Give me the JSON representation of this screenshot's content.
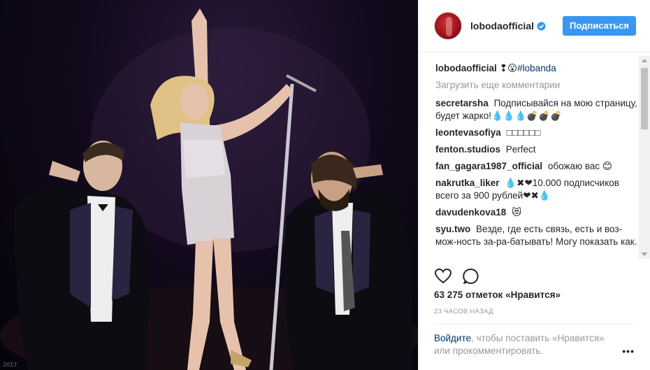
{
  "photo": {
    "watermark": "2017",
    "description_icon": "concert-photo"
  },
  "header": {
    "username": "lobodaofficial",
    "verified_icon": "verified-badge-icon",
    "follow_label": "Подписаться"
  },
  "caption": {
    "username": "lobodaofficial",
    "emoji": "❢😮",
    "hashtag": "#lobanda"
  },
  "load_more": "Загрузить еще комментарии",
  "comments": [
    {
      "user": "secretarsha",
      "text": "Подписывайся на мою страницу, будет жарко!💧💧💧💣💣💣"
    },
    {
      "user": "leontevasofiya",
      "text": "□□□□□□"
    },
    {
      "user": "fenton.studios",
      "text": "Perfect"
    },
    {
      "user": "fan_gagara1987_official",
      "text": "обожаю вас 😊"
    },
    {
      "user": "nakrutka_liker",
      "text": "💧✖❤10.000 подписчиков всего за 900 рублей❤✖💧"
    },
    {
      "user": "davudenkova18",
      "text": "😻"
    },
    {
      "user": "syu.two",
      "text": "Везде, где есть связь, есть и воз-мож-ность за-ра-батывать! Могу показать как."
    }
  ],
  "actions": {
    "like_icon": "heart-icon",
    "comment_icon": "comment-icon"
  },
  "likes": "63 275 отметок «Нравится»",
  "timestamp": "23 ЧАСОВ НАЗАД",
  "login": {
    "link": "Войдите",
    "text": ", чтобы поставить «Нравится» или прокомментировать."
  },
  "more_label": "•••",
  "colors": {
    "accent": "#3897f0",
    "link": "#003569",
    "muted": "#999999"
  }
}
